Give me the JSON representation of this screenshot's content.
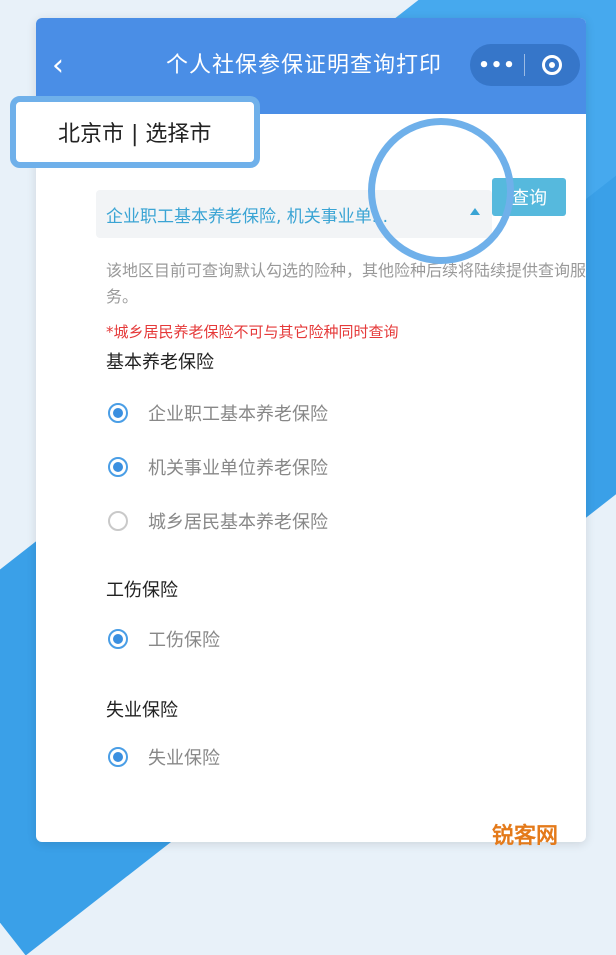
{
  "navbar": {
    "title": "个人社保参保证明查询打印",
    "more_icon": "•••"
  },
  "city": {
    "text": "北京市 | 选择市"
  },
  "select": {
    "value": "企业职工基本养老保险, 机关事业单..."
  },
  "query_button": "查询",
  "note": "该地区目前可查询默认勾选的险种，其他险种后续将陆续提供查询服务。",
  "warning": "*城乡居民养老保险不可与其它险种同时查询",
  "sections": [
    {
      "title": "基本养老保险",
      "options": [
        {
          "label": "企业职工基本养老保险",
          "checked": true
        },
        {
          "label": "机关事业单位养老保险",
          "checked": true
        },
        {
          "label": "城乡居民基本养老保险",
          "checked": false
        }
      ]
    },
    {
      "title": "工伤保险",
      "options": [
        {
          "label": "工伤保险",
          "checked": true
        }
      ]
    },
    {
      "title": "失业保险",
      "options": [
        {
          "label": "失业保险",
          "checked": true
        }
      ]
    }
  ],
  "watermark": "锐客网",
  "colors": {
    "navbar": "#4a8ee6",
    "accent": "#3a8fe0",
    "warning": "#e53939",
    "highlight": "#6fb0ea"
  }
}
